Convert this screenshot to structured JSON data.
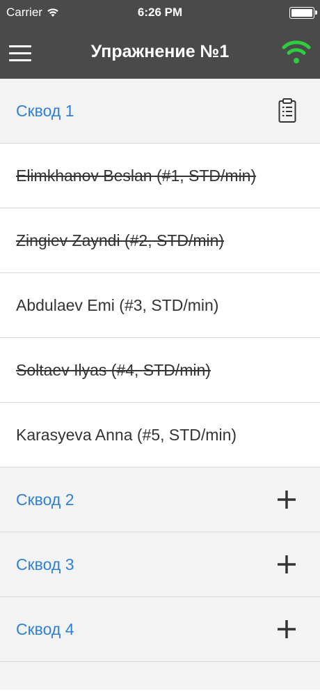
{
  "status_bar": {
    "carrier": "Carrier",
    "time": "6:26 PM"
  },
  "nav": {
    "title": "Упражнение №1",
    "menu_icon": "hamburger-icon",
    "status_icon": "wifi-icon",
    "status_color": "#2ecc40"
  },
  "sections": [
    {
      "label": "Сквод 1",
      "expanded": true,
      "icon": "clipboard-icon",
      "members": [
        {
          "name": "Elimkhanov Beslan (#1, STD/min)",
          "struck": true
        },
        {
          "name": "Zingiev Zayndi (#2, STD/min)",
          "struck": true
        },
        {
          "name": "Abdulaev Emi (#3, STD/min)",
          "struck": false
        },
        {
          "name": "Soltaev Ilyas (#4, STD/min)",
          "struck": true
        },
        {
          "name": "Karasyeva Anna (#5, STD/min)",
          "struck": false
        }
      ]
    },
    {
      "label": "Сквод 2",
      "expanded": false,
      "icon": "plus-icon"
    },
    {
      "label": "Сквод 3",
      "expanded": false,
      "icon": "plus-icon"
    },
    {
      "label": "Сквод 4",
      "expanded": false,
      "icon": "plus-icon"
    }
  ],
  "colors": {
    "accent": "#2f80d8",
    "bar": "#4a4a4a"
  }
}
